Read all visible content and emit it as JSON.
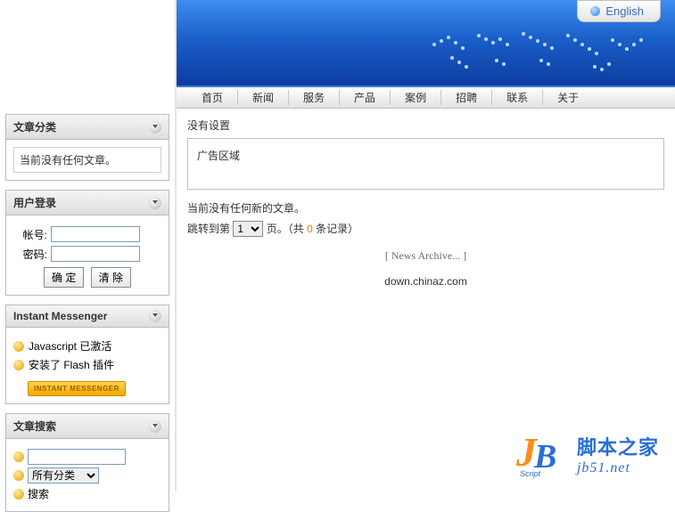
{
  "lang_label": "English",
  "nav": [
    "首页",
    "新闻",
    "服务",
    "产品",
    "案例",
    "招聘",
    "联系",
    "关于"
  ],
  "sidebar": {
    "categories": {
      "title": "文章分类",
      "empty": "当前没有任何文章。"
    },
    "login": {
      "title": "用户登录",
      "account_label": "帐号:",
      "password_label": "密码:",
      "submit": "确 定",
      "reset": "清 除"
    },
    "im": {
      "title": "Instant Messenger",
      "js": "Javascript 已激活",
      "flash": "安装了 Flash 插件",
      "badge": "INSTANT MESSENGER"
    },
    "search": {
      "title": "文章搜索",
      "all_option": "所有分类",
      "btn": "搜索"
    }
  },
  "main": {
    "not_set": "没有设置",
    "ad": "广告区域",
    "no_articles": "当前没有任何新的文章。",
    "pager_prefix": "跳转到第",
    "pager_page_option": "1",
    "pager_mid": "页。（共",
    "pager_count": "0",
    "pager_suffix": "条记录）",
    "archive_link": "[ News Archive... ]",
    "footer": "down.chinaz.com"
  },
  "watermark": {
    "cn": "脚本之家",
    "en": "jb51.net",
    "script": "Script"
  }
}
